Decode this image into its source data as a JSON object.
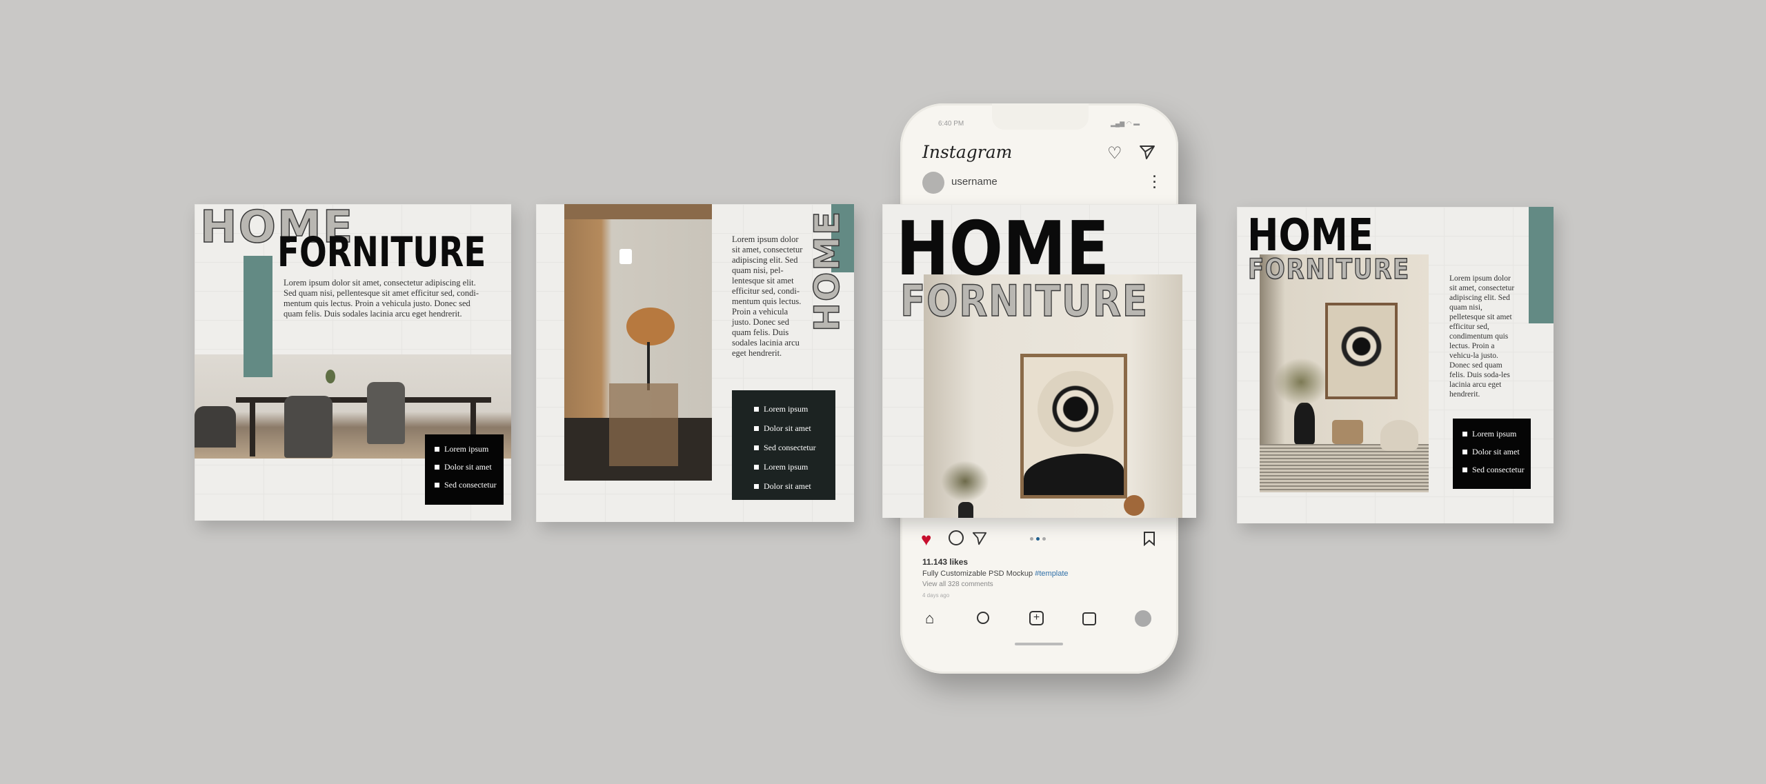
{
  "card1": {
    "outline_title": "HOME",
    "title": "FORNITURE",
    "paragraph": "Lorem ipsum dolor sit amet, consectetur adipiscing elit. Sed quam nisi, pellentesque sit amet efficitur sed, condi-mentum quis lectus. Proin a vehicula justo. Donec sed quam felis. Duis sodales lacinia arcu eget hendrerit.",
    "list": [
      "Lorem ipsum",
      "Dolor sit amet",
      "Sed consectetur"
    ]
  },
  "card2": {
    "outline_title": "HOME",
    "paragraph": "Lorem ipsum dolor sit amet, consectetur adipiscing elit. Sed quam nisi, pel-lentesque sit amet efficitur sed, condi-mentum quis lectus. Proin a vehicula justo. Donec sed quam felis. Duis sodales lacinia arcu eget hendrerit.",
    "list": [
      "Lorem ipsum",
      "Dolor sit amet",
      "Sed consectetur",
      "Lorem ipsum",
      "Dolor sit amet"
    ]
  },
  "phone": {
    "time": "6:40 PM",
    "app_name": "Instagram",
    "username": "username",
    "post": {
      "title": "HOME",
      "outline_title": "FORNITURE"
    },
    "likes": "11.143 likes",
    "caption": "Fully Customizable PSD Mockup",
    "hashtag": "#template",
    "comments": "View all 328 comments",
    "posted": "4 days ago",
    "carousel": {
      "pages": 3,
      "active": 2
    }
  },
  "card4": {
    "title": "HOME",
    "outline_title": "FORNITURE",
    "paragraph": "Lorem ipsum dolor sit amet, consectetur adipiscing elit. Sed quam nisi, pelletesque sit amet efficitur sed, condimentum quis lectus. Proin a vehicu-la justo. Donec sed quam felis. Duis soda-les lacinia arcu eget hendrerit.",
    "list": [
      "Lorem ipsum",
      "Dolor sit amet",
      "Sed consectetur"
    ]
  },
  "colors": {
    "teal": "#638a84",
    "like_red": "#c8102e",
    "hashtag": "#2f6fa8",
    "background": "#c9c8c6"
  }
}
